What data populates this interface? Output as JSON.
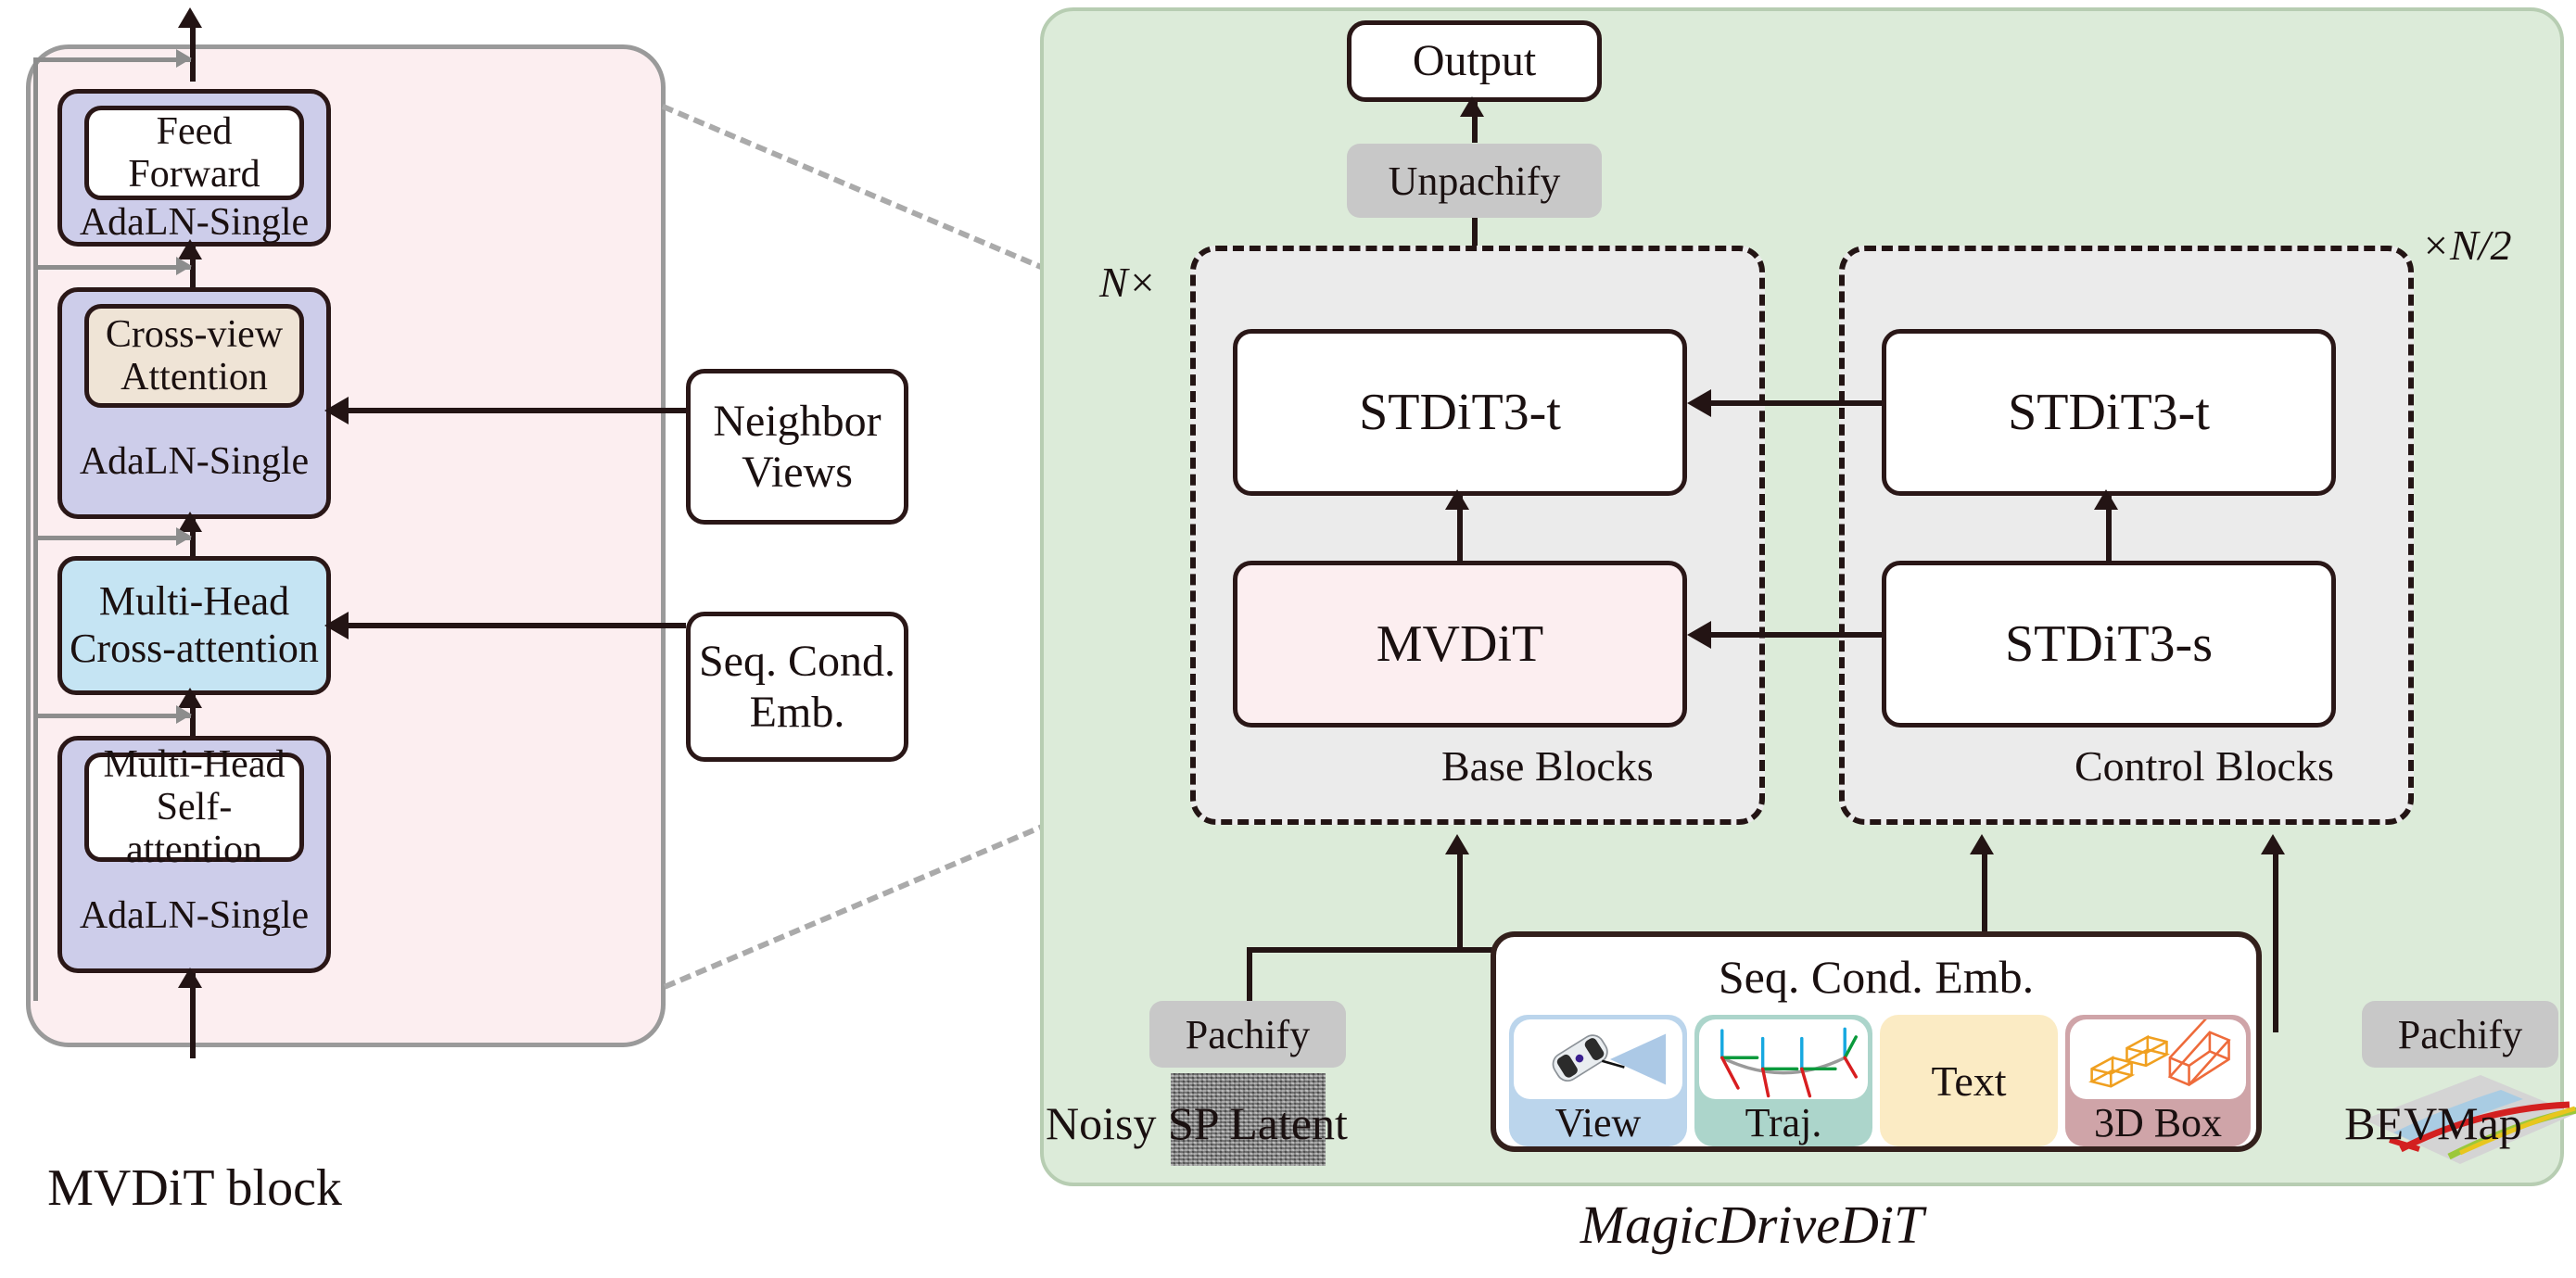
{
  "left_panel": {
    "caption": "MVDiT block",
    "blocks": [
      {
        "inner": "Feed Forward",
        "outer": "AdaLN-Single"
      },
      {
        "inner": "Cross-view Attention",
        "outer": "AdaLN-Single"
      },
      {
        "inner": "Multi-Head Cross-attention",
        "outer": ""
      },
      {
        "inner": "Multi-Head Self-attention",
        "outer": "AdaLN-Single"
      }
    ],
    "side_inputs": [
      {
        "label": "Neighbor Views"
      },
      {
        "label": "Seq. Cond. Emb."
      }
    ]
  },
  "right_panel": {
    "caption": "MagicDriveDiT",
    "output_label": "Output",
    "unpachify_label": "Unpachify",
    "base_group": {
      "title": "Base Blocks",
      "multiplier": "N×",
      "top_block": "STDiT3-t",
      "bottom_block": "MVDiT"
    },
    "control_group": {
      "title": "Control Blocks",
      "multiplier": "×N/2",
      "top_block": "STDiT3-t",
      "bottom_block": "STDiT3-s"
    },
    "inputs": {
      "latent": {
        "pachify": "Pachify",
        "label": "Noisy SP Latent"
      },
      "bevmap": {
        "pachify": "Pachify",
        "label": "BEVMap"
      }
    },
    "cond": {
      "title": "Seq. Cond. Emb.",
      "chips": [
        {
          "label": "View",
          "bg": "#BBD5EC",
          "icon": "camera-view-icon"
        },
        {
          "label": "Traj.",
          "bg": "#ACD5CB",
          "icon": "trajectory-icon"
        },
        {
          "label": "Text",
          "bg": "#FBEBC4",
          "icon": "text-icon"
        },
        {
          "label": "3D Box",
          "bg": "#CFA4A8",
          "icon": "3d-box-icon"
        }
      ]
    }
  },
  "colors": {
    "left_panel_bg": "#FCEEF0",
    "adaln_bg": "#CDCDEA",
    "crossview_bg": "#EFE4D6",
    "crossattn_bg": "#C5E4F3",
    "right_panel_bg": "#DCEBD9",
    "group_bg": "#EBEBEB",
    "mvdit_bg": "#FCEEF0",
    "chip_gray": "#C8C8C8"
  }
}
